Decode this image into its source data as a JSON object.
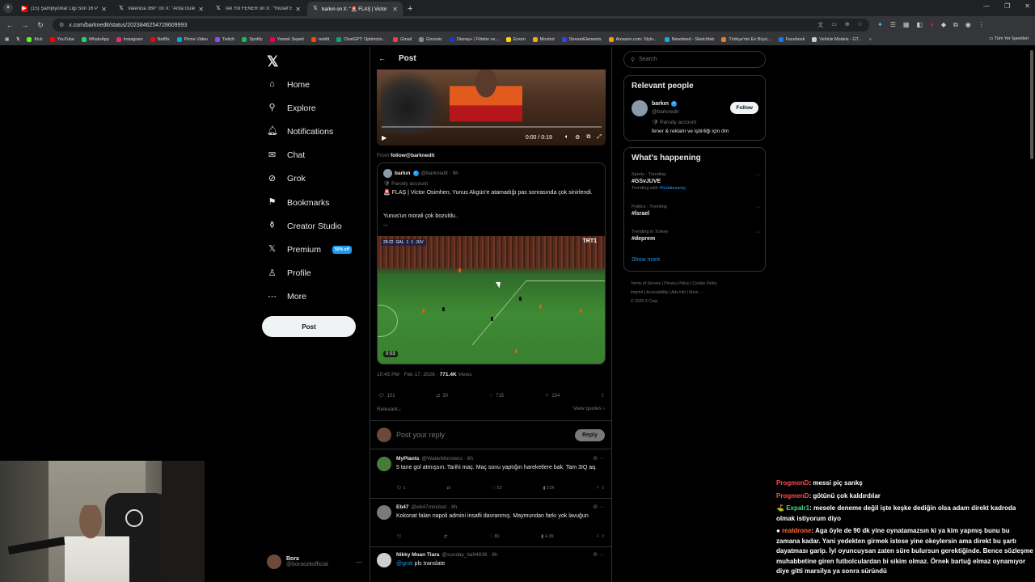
{
  "browser": {
    "tabs": [
      {
        "title": "(15) Şampiyonlar Ligi Son 16 Pl",
        "icon": "youtube-icon",
        "active": false
      },
      {
        "title": "Valencia 360° on X: \"Arda Guler",
        "icon": "x-icon",
        "active": false
      },
      {
        "title": "Tek Yol FENER on X: \"Yousef E",
        "icon": "x-icon",
        "active": false
      },
      {
        "title": "barkın on X: \"🚨 FLAŞ | Victor",
        "icon": "x-icon",
        "active": true
      }
    ],
    "url": "x.com/barknedit/status/2023846254728609993",
    "bookmarks": [
      {
        "label": "Kick",
        "color": "#53fc18"
      },
      {
        "label": "YouTube",
        "color": "#ff0000"
      },
      {
        "label": "WhatsApp",
        "color": "#25d366"
      },
      {
        "label": "Instagram",
        "color": "#e1306c"
      },
      {
        "label": "Netflix",
        "color": "#e50914"
      },
      {
        "label": "Prime Video",
        "color": "#00a8e1"
      },
      {
        "label": "Twitch",
        "color": "#9146ff"
      },
      {
        "label": "Spotify",
        "color": "#1db954"
      },
      {
        "label": "Yemek Sepeti",
        "color": "#ea004b"
      },
      {
        "label": "reddit",
        "color": "#ff4500"
      },
      {
        "label": "ChatGPT: Optimizin...",
        "color": "#10a37f"
      },
      {
        "label": "Gmail",
        "color": "#ea4335"
      },
      {
        "label": "Gnoosic",
        "color": "#888888"
      },
      {
        "label": "Disney+ | Filmler ve...",
        "color": "#113ccf"
      },
      {
        "label": "Exxen",
        "color": "#ffd500"
      },
      {
        "label": "Moobot",
        "color": "#f5a623"
      },
      {
        "label": "StreamElements",
        "color": "#3a44d1"
      },
      {
        "label": "Amazon.com: Stylo...",
        "color": "#ff9900"
      },
      {
        "label": "Newsfeed - Sketchfab",
        "color": "#1caad9"
      },
      {
        "label": "Türkiye'nin En Büyü...",
        "color": "#f27a1a"
      },
      {
        "label": "Facebook",
        "color": "#1877f2"
      },
      {
        "label": "Vehicle Models - GT...",
        "color": "#cccccc"
      }
    ],
    "bookmarks_more": "»",
    "all_bookmarks": "Tüm Yer İşaretleri"
  },
  "nav": {
    "items": [
      {
        "label": "Home",
        "icon": "home-icon",
        "glyph": "⌂"
      },
      {
        "label": "Explore",
        "icon": "search-icon",
        "glyph": "⚲"
      },
      {
        "label": "Notifications",
        "icon": "bell-icon",
        "glyph": "🔔︎"
      },
      {
        "label": "Chat",
        "icon": "mail-icon",
        "glyph": "✉"
      },
      {
        "label": "Grok",
        "icon": "grok-icon",
        "glyph": "⊘"
      },
      {
        "label": "Bookmarks",
        "icon": "bookmark-icon",
        "glyph": "⚑"
      },
      {
        "label": "Creator Studio",
        "icon": "creator-icon",
        "glyph": "⚱"
      },
      {
        "label": "Premium",
        "icon": "x-premium-icon",
        "glyph": "𝕏"
      },
      {
        "label": "Profile",
        "icon": "profile-icon",
        "glyph": "♙"
      },
      {
        "label": "More",
        "icon": "more-icon",
        "glyph": "⋯"
      }
    ],
    "premium_badge": "50% off",
    "post_button": "Post",
    "account": {
      "name": "Bora",
      "handle": "@boraozkofficial"
    }
  },
  "main": {
    "header_title": "Post",
    "video1": {
      "time": "0:00 / 0:19"
    },
    "from": {
      "prefix": "From",
      "handle": "follow@barknedit"
    },
    "quote": {
      "name": "barkın",
      "handle": "@barknedit · 9h",
      "parody": "Parody account",
      "text1": "🚨 FLAŞ | Victor Osimhen, Yunus Akgün'e atamadığı pas sonrasında çok sinirlendi.",
      "text2": "Yunus'un morali çok bozuldu..",
      "text3": "...",
      "video_time": "0:03",
      "scoreboard": [
        "29:22",
        "GAL",
        "1",
        "1",
        "JUV"
      ],
      "broadcaster": "TRT1"
    },
    "meta": {
      "time": "10:45 PM · Feb 17, 2026 · ",
      "views": "771.4K",
      "views_label": " Views"
    },
    "actions": {
      "replies": "101",
      "reposts": "30",
      "likes": "715",
      "bookmarks": "154"
    },
    "sort_label": "Relevant",
    "view_quotes": "View quotes",
    "reply_placeholder": "Post your reply",
    "reply_button": "Reply",
    "replies": [
      {
        "name": "MyPlants",
        "handle": "@WaterMonsterz · 8h",
        "text": "5 tane gol atmışsın. Tarihi maç. Maç sonu yaptığın hareketlere bak. Tam 3IQ aq.",
        "replies": "1",
        "reposts": "",
        "likes": "52",
        "views": "21K",
        "color": "#4a7a3a"
      },
      {
        "name": "Eb47",
        "handle": "@eb47mindset · 8h",
        "text": "Kokonat falan napoli admini insafli davranmış. Maymundan farkı yok lavuğun",
        "replies": "",
        "reposts": "",
        "likes": "80",
        "views": "4.3K",
        "color": "#7a7a7a"
      },
      {
        "name": "Nikky Moan Tiara",
        "handle": "@sunday_tia94836 · 8h",
        "mention": "@grok",
        "text": " pls translate",
        "replies": "2",
        "reposts": "",
        "likes": "1",
        "views": "23K",
        "color": "#cfcfcf"
      }
    ]
  },
  "right": {
    "search_placeholder": "Search",
    "relevant_title": "Relevant people",
    "person": {
      "name": "barkın",
      "handle": "@barknedit",
      "follow": "Follow",
      "parody": "Parody account",
      "bio": "fener & reklam ve işbirliği için dm"
    },
    "happening_title": "What's happening",
    "trends": [
      {
        "category": "Sports · Trending",
        "tag": "#GSvJUVE",
        "sub_prefix": "Trending with ",
        "sub_link": "#Galatasaray"
      },
      {
        "category": "Politics · Trending",
        "tag": "#İsrael",
        "sub_prefix": "",
        "sub_link": ""
      },
      {
        "category": "Trending in Turkey",
        "tag": "#deprem",
        "sub_prefix": "",
        "sub_link": ""
      }
    ],
    "show_more": "Show more",
    "footer": [
      "Terms of Service",
      "Privacy Policy",
      "Cookie Policy",
      "Imprint",
      "Accessibility",
      "Ads info",
      "More ···",
      "© 2026 X Corp."
    ]
  },
  "chat": [
    {
      "user": "ProgmenD",
      "text": ": messi piç sankş",
      "cls": "u1",
      "prefix": ""
    },
    {
      "user": "ProgmenD",
      "text": ": götünü çok kaldırdılar",
      "cls": "u1",
      "prefix": ""
    },
    {
      "user": "Expalr1",
      "text": ": mesele deneme değil işte keşke dediğin olsa adam direkt kadroda olmak istiyorum diyo",
      "cls": "u2",
      "prefix": "⛳ "
    },
    {
      "user": "realdrone",
      "text": ": Aga öyle de 90 dk yine oynatamazsın ki ya kim yapmış bunu bu zamana kadar. Yani yedekten girmek istese yine okeylersin ama direkt bu şartı dayatması garip. İyi oyuncuysan zaten süre bulursun gerektiğinde. Bence sözleşme muhabbetine giren futbolculardan bi sikim olmaz. Örnek bartuğ elmaz oynamıyor diye gitti marsilya ya sonra süründü",
      "cls": "u3",
      "prefix": "● "
    }
  ]
}
